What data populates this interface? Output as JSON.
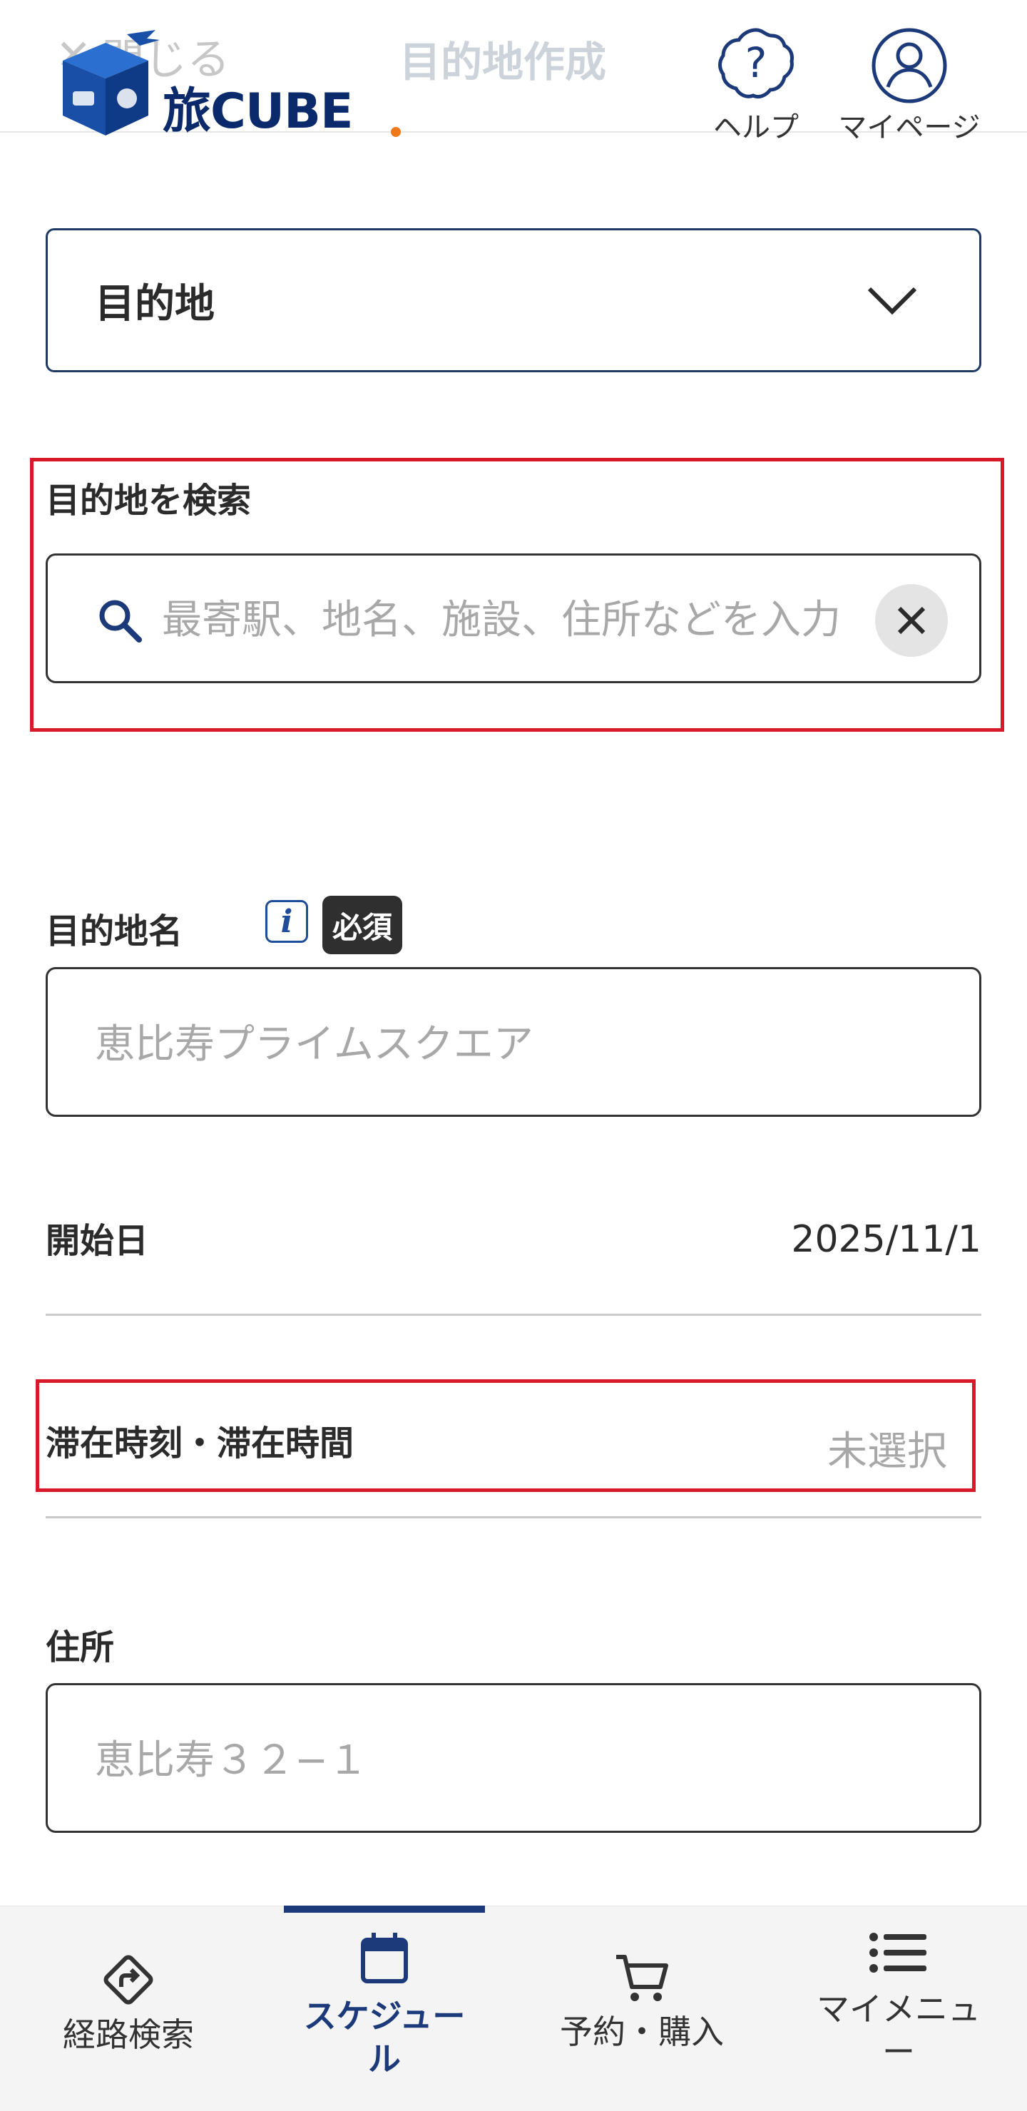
{
  "header": {
    "close_label": "閉じる",
    "title": "目的地作成",
    "logo_text": "旅CUBE",
    "help_label": "ヘルプ",
    "mypage_label": "マイページ"
  },
  "form": {
    "type_select_value": "目的地",
    "search": {
      "label": "目的地を検索",
      "placeholder": "最寄駅、地名、施設、住所などを入力"
    },
    "name": {
      "label": "目的地名",
      "required_badge": "必須",
      "placeholder": "恵比寿プライムスクエア"
    },
    "start_date": {
      "label": "開始日",
      "value": "2025/11/1"
    },
    "stay": {
      "label": "滞在時刻・滞在時間",
      "value": "未選択"
    },
    "address": {
      "label": "住所",
      "placeholder": "恵比寿３２−１"
    }
  },
  "bottom_nav": {
    "items": [
      {
        "label": "経路検索",
        "icon": "route-sign-icon"
      },
      {
        "label": "スケジュール",
        "icon": "calendar-icon"
      },
      {
        "label": "予約・購入",
        "icon": "cart-icon"
      },
      {
        "label": "マイメニュー",
        "icon": "menu-list-icon"
      }
    ],
    "active_index": 1
  },
  "colors": {
    "accent_navy": "#1c3a7a",
    "highlight_red": "#d7192a",
    "logo_orange": "#f07a1a"
  }
}
